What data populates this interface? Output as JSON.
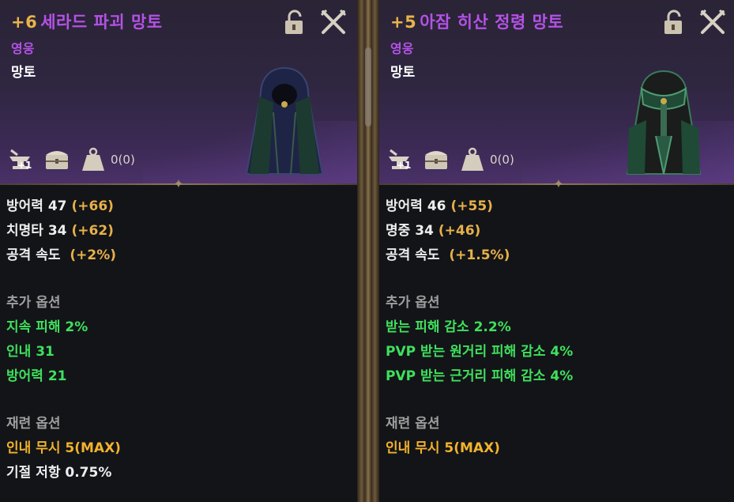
{
  "items": [
    {
      "enhance": "+6",
      "name": "세라드 파괴 망토",
      "grade": "영웅",
      "type": "망토",
      "weight_value": "0(0)",
      "enhance_icon_badge": "+1",
      "base_stats": [
        {
          "label": "방어력 47",
          "bonus": "(+66)"
        },
        {
          "label": "치명타 34",
          "bonus": "(+62)"
        },
        {
          "label": "공격 속도 ",
          "bonus": "(+2%)"
        }
      ],
      "extra_title": "추가 옵션",
      "extra_options": [
        "지속 피해 2%",
        "인내 31",
        "방어력 21"
      ],
      "reforge_title": "재련 옵션",
      "reforge_options": [
        {
          "text": "인내 무시 5(MAX)",
          "style": "orange"
        },
        {
          "text": "기절 저항 0.75%",
          "style": "white"
        }
      ],
      "cloak_color": "#1e2446"
    },
    {
      "enhance": "+5",
      "name": "아잠 히산 정령 망토",
      "grade": "영웅",
      "type": "망토",
      "weight_value": "0(0)",
      "enhance_icon_badge": "+1",
      "base_stats": [
        {
          "label": "방어력 46",
          "bonus": "(+55)"
        },
        {
          "label": "명중 34",
          "bonus": "(+46)"
        },
        {
          "label": "공격 속도 ",
          "bonus": "(+1.5%)"
        }
      ],
      "extra_title": "추가 옵션",
      "extra_options": [
        "받는 피해 감소 2.2%",
        "PVP 받는 원거리 피해 감소 4%",
        "PVP 받는 근거리 피해 감소 4%"
      ],
      "reforge_title": "재련 옵션",
      "reforge_options": [
        {
          "text": "인내 무시 5(MAX)",
          "style": "orange"
        }
      ],
      "cloak_color": "#1f4a35"
    }
  ],
  "icons": {
    "lock": "unlock-padlock-icon",
    "close": "crossed-swords-close-icon",
    "enhance": "anvil-icon",
    "storage": "chest-icon",
    "weight": "weight-icon"
  }
}
